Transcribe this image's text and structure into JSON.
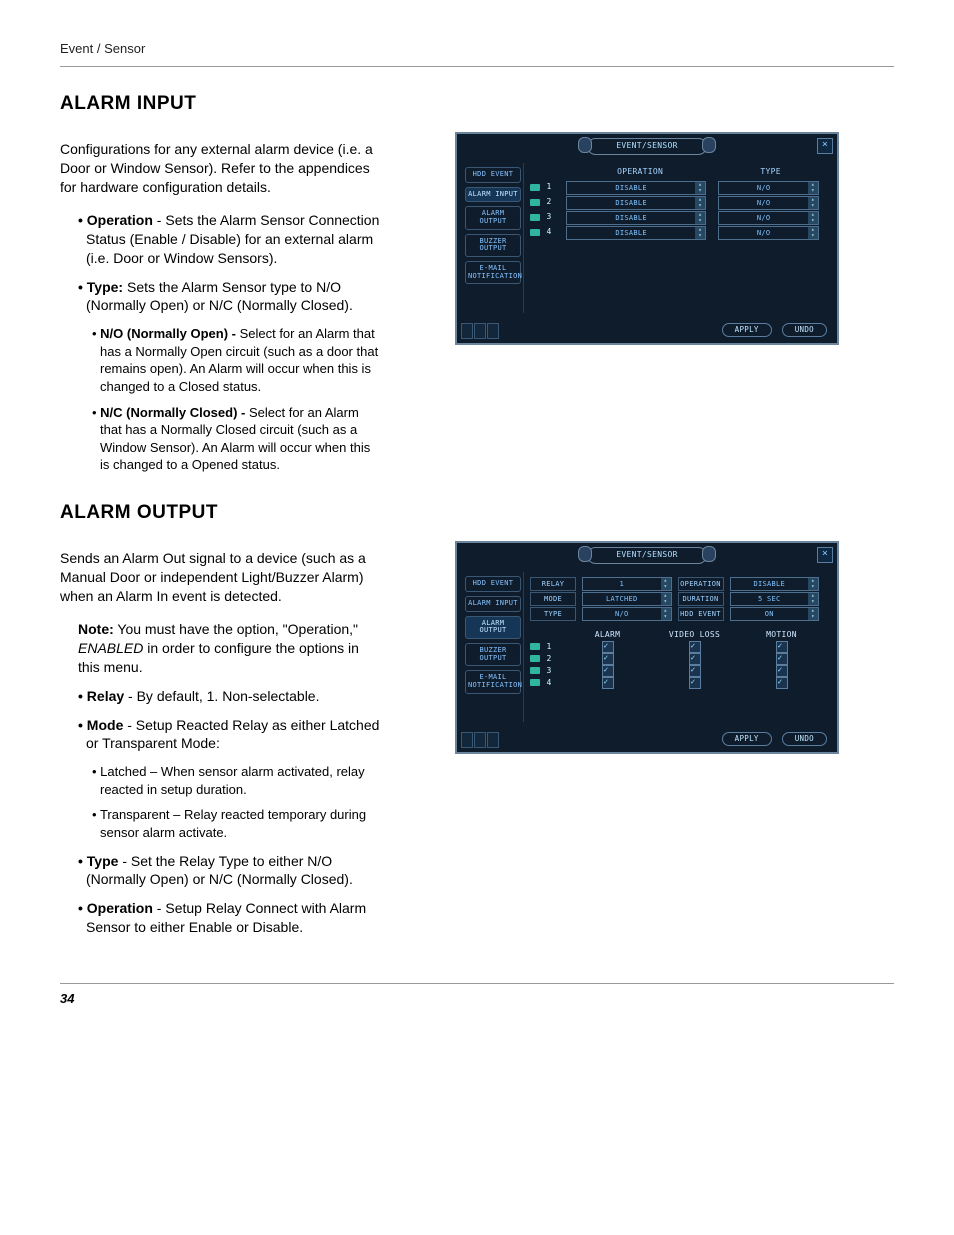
{
  "header": {
    "breadcrumb": "Event / Sensor"
  },
  "footer": {
    "page_number": "34"
  },
  "sections": {
    "alarm_input": {
      "heading": "ALARM INPUT",
      "intro": "Configurations for any external alarm device (i.e. a Door or Window Sensor). Refer to the appendices for hardware configuration details.",
      "bullets": {
        "operation": {
          "label": "Operation",
          "text": " - Sets the Alarm Sensor Connection Status (Enable / Disable) for an external alarm (i.e. Door or Window Sensors)."
        },
        "type": {
          "label": "Type:",
          "text": " Sets the Alarm Sensor type to N/O (Normally Open) or N/C (Normally Closed)."
        },
        "no": {
          "label": "N/O (Normally Open) - ",
          "text": "Select for an Alarm that has a Normally Open circuit (such as a door that remains open). An Alarm will occur when this is changed to a Closed status."
        },
        "nc": {
          "label": "N/C (Normally Closed) - ",
          "text": "Select for an Alarm that has a Normally Closed circuit (such as a Window Sensor). An Alarm will occur when this is changed to a Opened status."
        }
      }
    },
    "alarm_output": {
      "heading": "ALARM OUTPUT",
      "intro": "Sends an Alarm Out signal to a device (such as a Manual Door or independent Light/Buzzer Alarm) when an Alarm In event is detected.",
      "note_label": "Note:",
      "note_text_a": " You must have the option, \"Operation,\" ",
      "note_em": "ENABLED",
      "note_text_b": " in order to configure the options in this menu.",
      "bullets": {
        "relay": {
          "label": "Relay",
          "text": " - By default, 1. Non-selectable."
        },
        "mode": {
          "label": "Mode",
          "text": " - Setup Reacted Relay as either Latched or Transparent Mode:"
        },
        "mode_sub": {
          "latched": "Latched – When sensor alarm activated, relay reacted in setup duration.",
          "transparent": "Transparent – Relay reacted temporary during sensor alarm activate."
        },
        "type": {
          "label": "Type",
          "text": " - Set the Relay Type to either N/O (Normally Open) or N/C (Normally Closed)."
        },
        "operation": {
          "label": "Operation",
          "text": " - Setup Relay Connect with Alarm Sensor to either Enable or Disable."
        }
      }
    }
  },
  "figures": {
    "common": {
      "title": "EVENT/SENSOR",
      "close": "×",
      "sidebar": [
        "HDD EVENT",
        "ALARM INPUT",
        "ALARM OUTPUT",
        "BUZZER OUTPUT",
        "E-MAIL NOTIFICATION"
      ],
      "buttons": {
        "apply": "APPLY",
        "undo": "UNDO"
      }
    },
    "fig1": {
      "active_sidebar_index": 1,
      "headers": {
        "operation": "OPERATION",
        "type": "TYPE"
      },
      "rows": [
        {
          "n": "1",
          "operation": "DISABLE",
          "type": "N/O"
        },
        {
          "n": "2",
          "operation": "DISABLE",
          "type": "N/O"
        },
        {
          "n": "3",
          "operation": "DISABLE",
          "type": "N/O"
        },
        {
          "n": "4",
          "operation": "DISABLE",
          "type": "N/O"
        }
      ]
    },
    "fig2": {
      "active_sidebar_index": 2,
      "fields": {
        "relay": {
          "label": "RELAY",
          "value": "1"
        },
        "operation": {
          "label": "OPERATION",
          "value": "DISABLE"
        },
        "mode": {
          "label": "MODE",
          "value": "LATCHED"
        },
        "duration": {
          "label": "DURATION",
          "value": "5 SEC"
        },
        "type": {
          "label": "TYPE",
          "value": "N/O"
        },
        "hdd_event": {
          "label": "HDD EVENT",
          "value": "ON"
        }
      },
      "grid": {
        "headers": [
          "ALARM",
          "VIDEO LOSS",
          "MOTION"
        ],
        "rows": [
          {
            "n": "1",
            "checks": [
              true,
              true,
              true
            ]
          },
          {
            "n": "2",
            "checks": [
              true,
              true,
              true
            ]
          },
          {
            "n": "3",
            "checks": [
              true,
              true,
              true
            ]
          },
          {
            "n": "4",
            "checks": [
              true,
              true,
              true
            ]
          }
        ]
      }
    }
  }
}
